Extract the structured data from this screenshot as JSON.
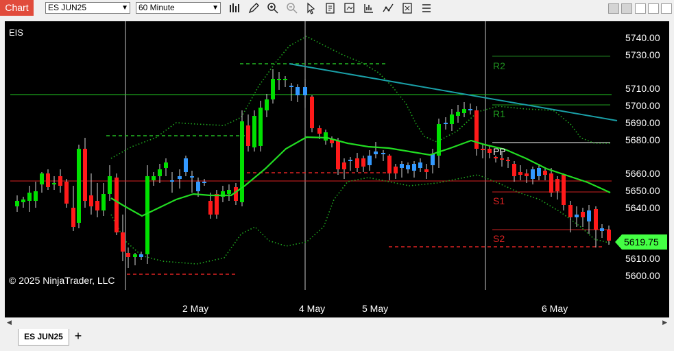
{
  "toolbar": {
    "chart_tab_label": "Chart",
    "instrument": "ES JUN25",
    "interval": "60 Minute",
    "icons": [
      "bar-type-icon",
      "draw-tool-icon",
      "zoom-in-icon",
      "zoom-out-icon",
      "pointer-icon",
      "data-box-icon",
      "properties-icon",
      "indicators-icon",
      "strategies-icon",
      "template-icon",
      "more-icon"
    ]
  },
  "window_buttons": [
    "minimize-icon",
    "restore-icon",
    "maximize-icon",
    "close-icon"
  ],
  "chart": {
    "symbol_label": "EIS",
    "copyright": "© 2025 NinjaTrader, LLC",
    "current_price": "5619.75",
    "price_ticks": [
      "5740.00",
      "5730.00",
      "5710.00",
      "5700.00",
      "5690.00",
      "5680.00",
      "5660.00",
      "5650.00",
      "5640.00",
      "5610.00",
      "5600.00"
    ],
    "date_labels": [
      "2 May",
      "4 May",
      "5 May",
      "6 May"
    ],
    "pivot_labels": [
      "R2",
      "R1",
      "PP",
      "S1",
      "S2"
    ],
    "colors": {
      "up": "#00e000",
      "down": "#ff1a1a",
      "doji": "#3399ff",
      "sma": "#22dd22",
      "trend": "#1aa0a8",
      "price_tag": "#44ff44"
    }
  },
  "bottom_tabs": {
    "active": "ES JUN25",
    "add": "+"
  }
}
